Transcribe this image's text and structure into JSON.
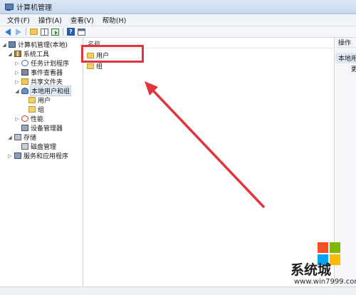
{
  "window": {
    "title": "计算机管理"
  },
  "menu": [
    "文件(F)",
    "操作(A)",
    "查看(V)",
    "帮助(H)"
  ],
  "toolbar": {
    "icons": [
      "back-icon",
      "forward-icon",
      "up-folder-icon",
      "show-tree-icon",
      "export-icon",
      "help-icon",
      "action-pane-icon"
    ],
    "help_glyph": "?"
  },
  "tree": {
    "root": "计算机管理(本地)",
    "system_tools": "系统工具",
    "task_scheduler": "任务计划程序",
    "event_viewer": "事件查看器",
    "shared_folders": "共享文件夹",
    "local_users_groups": "本地用户和组",
    "users": "用户",
    "groups": "组",
    "performance": "性能",
    "device_manager": "设备管理器",
    "storage": "存储",
    "disk_management": "磁盘管理",
    "services_apps": "服务和应用程序"
  },
  "list": {
    "header": "名称",
    "items": [
      "用户",
      "组"
    ]
  },
  "actions": {
    "header": "操作",
    "section": "本地用户和组",
    "link": "更多操作"
  },
  "colors": {
    "highlight": "#e0353a",
    "arrow": "#e0353a",
    "selection": "#e3ebf6"
  },
  "watermark": {
    "title": "系统城",
    "url": "www.win7999.com",
    "logo_colors": [
      "#f25022",
      "#7fba00",
      "#00a4ef",
      "#ffb900"
    ]
  }
}
